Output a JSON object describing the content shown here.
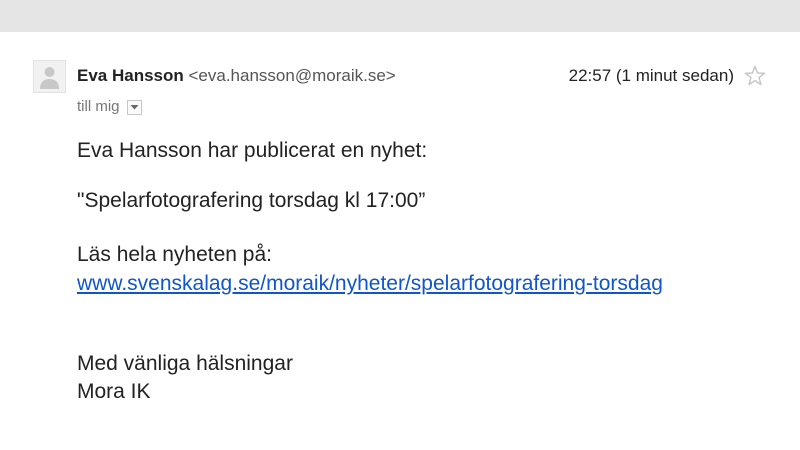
{
  "message": {
    "sender_name": "Eva Hansson",
    "sender_email": "<eva.hansson@moraik.se>",
    "timestamp": "22:57 (1 minut sedan)",
    "recipient": "till mig",
    "icons": {
      "avatar": "avatar-icon",
      "star": "star-icon",
      "details": "chevron-down-icon"
    }
  },
  "body": {
    "intro": "Eva Hansson har publicerat en nyhet:",
    "headline": "\"Spelarfotografering torsdag kl 17:00”",
    "read_more": "Läs hela nyheten på:",
    "link_text": "www.svenskalag.se/moraik/nyheter/spelarfotografering-torsdag",
    "greeting": "Med vänliga hälsningar",
    "signature": "Mora IK"
  },
  "colors": {
    "top_bar": "#e5e5e5",
    "text": "#222222",
    "link": "#1155cc",
    "muted": "#777777"
  }
}
